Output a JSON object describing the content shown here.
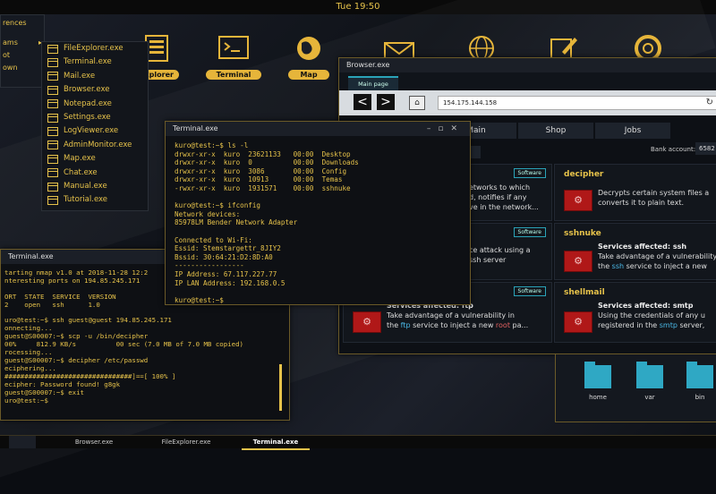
{
  "topbar": {
    "clock": "Tue 19:50"
  },
  "desktop_icons": [
    {
      "label": "Explorer"
    },
    {
      "label": "Terminal"
    },
    {
      "label": "Map"
    }
  ],
  "start_menu": {
    "items": [
      "rences",
      "ams",
      "ot",
      "own"
    ]
  },
  "sub_menu": {
    "items": [
      "FileExplorer.exe",
      "Terminal.exe",
      "Mail.exe",
      "Browser.exe",
      "Notepad.exe",
      "Settings.exe",
      "LogViewer.exe",
      "AdminMonitor.exe",
      "Map.exe",
      "Chat.exe",
      "Manual.exe",
      "Tutorial.exe"
    ]
  },
  "terminal_front": {
    "title": "Terminal.exe",
    "lines": [
      "kuro@test:~$ ls -l",
      "drwxr-xr-x  kuro  23621133   00:00  Desktop",
      "drwxr-xr-x  kuro  0          00:00  Downloads",
      "drwxr-xr-x  kuro  3086       00:00  Config",
      "drwxr-xr-x  kuro  10913      00:00  Temas",
      "-rwxr-xr-x  kuro  1931571    00:00  sshnuke",
      "",
      "kuro@test:~$ ifconfig",
      "Network devices:",
      "85978LM Bender Network Adapter",
      "",
      "Connected to Wi-Fi:",
      "Essid: Stemstargettr_8JIY2",
      "Bssid: 30:64:21:D2:8D:A0",
      "-----------------",
      "IP Address: 67.117.227.77",
      "IP LAN Address: 192.168.0.5",
      "",
      "kuro@test:~$"
    ]
  },
  "terminal_back": {
    "title": "Terminal.exe",
    "lines": [
      "tarting nmap v1.0 at 2018-11-28 12:2",
      "nteresting ports on 194.85.245.171",
      "",
      "ORT  STATE  SERVICE  VERSION",
      "2    open   ssh      1.0",
      "",
      "uro@test:~$ ssh guest@guest 194.85.245.171",
      "onnecting...",
      "guest@S00007:~$ scp -u /bin/decipher",
      "00%     812.9 KB/s          00 sec (7.0 MB of 7.0 MB copied)",
      "rocessing...",
      "guest@S00007:~$ decipher /etc/passwd",
      "eciphering...",
      "################################]==[ 100% ]",
      "ecipher: Password found! g8gk",
      "guest@S00007:~$ exit",
      "uro@test:~$"
    ]
  },
  "browser": {
    "title": "Browser.exe",
    "tab": "Main page",
    "address": "154.175.144.158",
    "back_icon": "<",
    "forward_icon": ">",
    "home_icon": "⌂",
    "reload_icon": "↻",
    "nav_tabs": [
      "Main",
      "Shop",
      "Jobs"
    ],
    "bank_label": "Bank account:",
    "bank_value": "6582",
    "cards": [
      {
        "name": "",
        "badge": "Software",
        "text": "etworks to which\nd, notifies if any\nve in the network..."
      },
      {
        "name": "decipher",
        "badge": "",
        "text": "Decrypts certain system files a\nconverts it to plain text."
      },
      {
        "name": "",
        "badge": "Software",
        "text": "ce attack using a\nssh server"
      },
      {
        "name": "sshnuke",
        "badge": "",
        "title": "Services affected: ssh",
        "text_pre": "Take advantage of a vulnerability",
        "text_hl1": "the ",
        "service": "ssh",
        "text_post": " service to inject a new"
      },
      {
        "name": "",
        "badge": "Software",
        "title": "Services affected: ftp",
        "text_pre": "Take advantage of a vulnerability in",
        "text_hl1": "the ",
        "service": "ftp",
        "text_mid": " service to inject a new ",
        "root": "root",
        "text_post": " pa..."
      },
      {
        "name": "shellmail",
        "badge": "",
        "title": "Services affected: smtp",
        "text_pre": "Using the credentials of any u",
        "text_hl1": "registered in the ",
        "service": "smtp",
        "text_post": " server,"
      }
    ]
  },
  "folders": [
    "home",
    "var",
    "bin"
  ],
  "taskbar": {
    "items": [
      "Browser.exe",
      "FileExplorer.exe",
      "Terminal.exe"
    ]
  }
}
